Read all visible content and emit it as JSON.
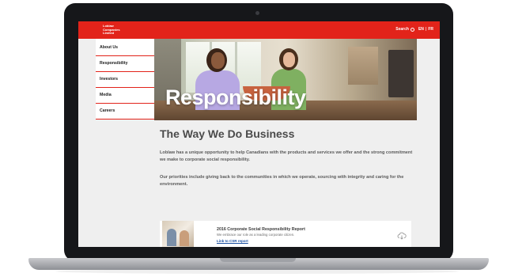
{
  "header": {
    "logo_line1": "Loblaw",
    "logo_line2": "Companies",
    "logo_line3": "Limited",
    "search_label": "Search",
    "lang_en": "EN",
    "lang_fr": "FR"
  },
  "sidebar": {
    "items": [
      {
        "label": "About Us"
      },
      {
        "label": "Responsibility"
      },
      {
        "label": "Investors"
      },
      {
        "label": "Media"
      },
      {
        "label": "Careers"
      }
    ]
  },
  "hero": {
    "title": "Responsibility"
  },
  "main": {
    "heading": "The Way We Do Business",
    "paragraph1": "Loblaw has a unique opportunity to help Canadians with the products and services we offer and the strong commitment we make to corporate social responsibility.",
    "paragraph2": "Our priorities include giving back to the communities in which we operate, sourcing with integrity and caring for the environment."
  },
  "report": {
    "title": "2016 Corporate Social Responsibility Report",
    "description": "We embrace our role as a leading corporate citizen.",
    "link": "Link to CSR report"
  },
  "colors": {
    "brand_red": "#e2231a",
    "link_blue": "#1a4fa0"
  }
}
